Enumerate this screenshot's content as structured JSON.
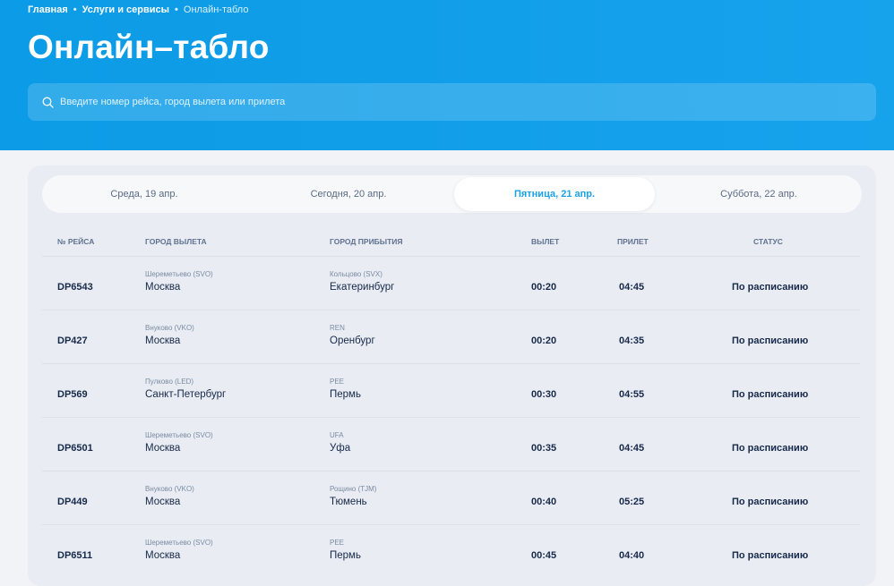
{
  "breadcrumb": {
    "items": [
      "Главная",
      "Услуги и сервисы"
    ],
    "current": "Онлайн-табло"
  },
  "page": {
    "title": "Онлайн–табло"
  },
  "search": {
    "placeholder": "Введите номер рейса, город вылета или прилета",
    "value": "",
    "icon": "search-icon"
  },
  "tabs": [
    {
      "label": "Среда, 19 апр.",
      "active": false
    },
    {
      "label": "Сегодня, 20 апр.",
      "active": false
    },
    {
      "label": "Пятница, 21 апр.",
      "active": true
    },
    {
      "label": "Суббота, 22 апр.",
      "active": false
    }
  ],
  "table": {
    "headers": {
      "flight": "№ РЕЙСА",
      "from": "ГОРОД ВЫЛЕТА",
      "to": "ГОРОД ПРИБЫТИЯ",
      "dep": "ВЫЛЕТ",
      "arr": "ПРИЛЕТ",
      "status": "СТАТУС"
    },
    "rows": [
      {
        "flight": "DP6543",
        "from_airport": "Шереметьево (SVO)",
        "from_city": "Москва",
        "to_airport": "Кольцово (SVX)",
        "to_city": "Екатеринбург",
        "dep": "00:20",
        "arr": "04:45",
        "status": "По расписанию"
      },
      {
        "flight": "DP427",
        "from_airport": "Внуково (VKO)",
        "from_city": "Москва",
        "to_airport": "REN",
        "to_city": "Оренбург",
        "dep": "00:20",
        "arr": "04:35",
        "status": "По расписанию"
      },
      {
        "flight": "DP569",
        "from_airport": "Пулково (LED)",
        "from_city": "Санкт-Петербург",
        "to_airport": "PEE",
        "to_city": "Пермь",
        "dep": "00:30",
        "arr": "04:55",
        "status": "По расписанию"
      },
      {
        "flight": "DP6501",
        "from_airport": "Шереметьево (SVO)",
        "from_city": "Москва",
        "to_airport": "UFA",
        "to_city": "Уфа",
        "dep": "00:35",
        "arr": "04:45",
        "status": "По расписанию"
      },
      {
        "flight": "DP449",
        "from_airport": "Внуково (VKO)",
        "from_city": "Москва",
        "to_airport": "Рощино (TJM)",
        "to_city": "Тюмень",
        "dep": "00:40",
        "arr": "05:25",
        "status": "По расписанию"
      },
      {
        "flight": "DP6511",
        "from_airport": "Шереметьево (SVO)",
        "from_city": "Москва",
        "to_airport": "PEE",
        "to_city": "Пермь",
        "dep": "00:45",
        "arr": "04:40",
        "status": "По расписанию"
      }
    ]
  },
  "colors": {
    "brand": "#0c9be6",
    "active_tab_text": "#1ba1e8",
    "text_dark": "#17294a"
  }
}
